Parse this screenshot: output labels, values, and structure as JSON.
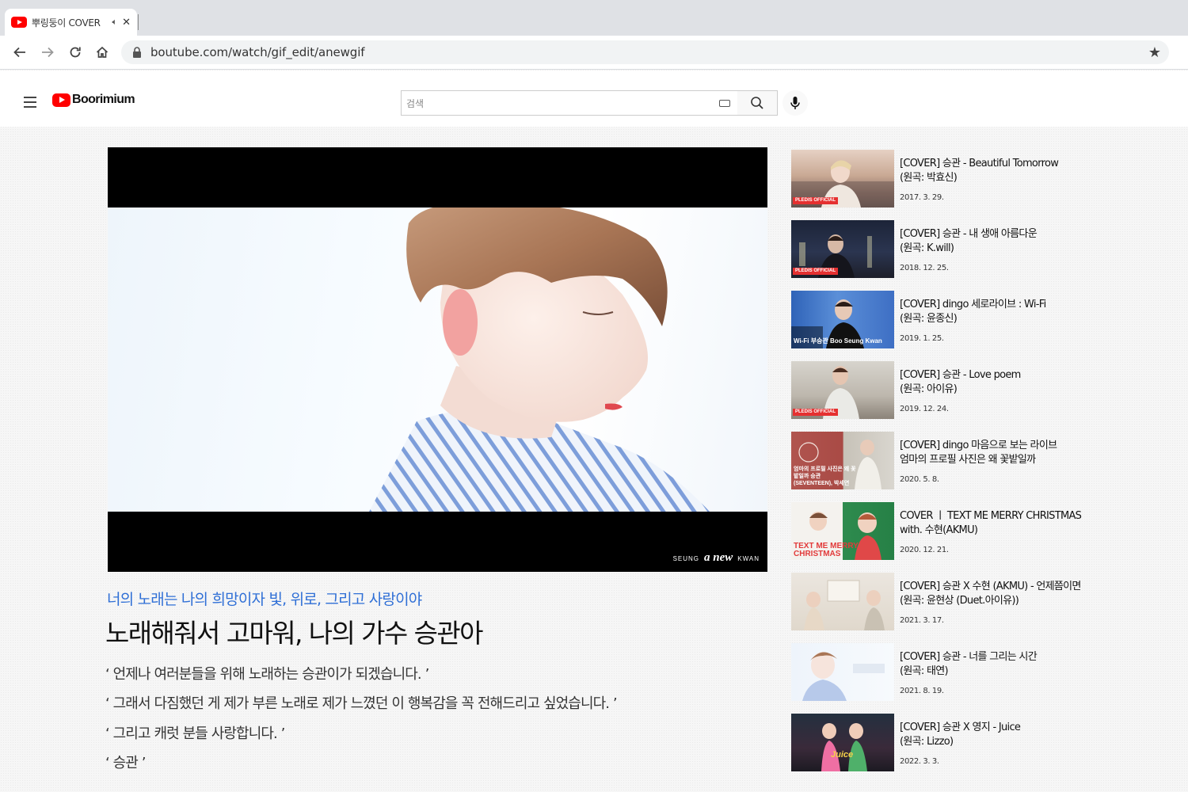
{
  "browser": {
    "tab_title": "뿌링둥이 COVER",
    "url": "boutube.com/watch/gif_edit/anewgif"
  },
  "header": {
    "logo_text": "Boorimium",
    "search_placeholder": "검색"
  },
  "video": {
    "watermark_left": "SEUNG",
    "watermark_center": "a new",
    "watermark_right": "KWAN"
  },
  "main": {
    "subtitle": "너의 노래는 나의 희망이자 빛, 위로, 그리고 사랑이야",
    "title": "노래해줘서 고마워, 나의 가수 승관아",
    "quotes": [
      "‘ 언제나 여러분들을 위해 노래하는 승관이가 되겠습니다. ’",
      "‘ 그래서 다짐했던 게 제가 부른 노래로 제가 느꼈던 이 행복감을 꼭 전해드리고 싶었습니다. ’",
      "‘ 그리고 캐럿 분들 사랑합니다. ’",
      "‘ 승관 ’"
    ]
  },
  "related": [
    {
      "line1": "[COVER] 승관 - Beautiful Tomorrow",
      "line2": "(원곡: 박효신)",
      "date": "2017. 3. 29.",
      "badge": "PLEDIS OFFICIAL",
      "overlay": ""
    },
    {
      "line1": "[COVER] 승관 - 내 생애 아름다운",
      "line2": "(원곡: K.will)",
      "date": "2018. 12. 25.",
      "badge": "PLEDIS OFFICIAL",
      "overlay": ""
    },
    {
      "line1": "[COVER] dingo 세로라이브 : Wi-Fi",
      "line2": "(원곡: 윤종신)",
      "date": "2019. 1. 25.",
      "badge": "",
      "overlay": "Wi-Fi 부승관 Boo Seung Kwan"
    },
    {
      "line1": "[COVER] 승관 - Love poem",
      "line2": "(원곡: 아이유)",
      "date": "2019. 12. 24.",
      "badge": "PLEDIS OFFICIAL",
      "overlay": ""
    },
    {
      "line1": "[COVER] dingo 마음으로 보는 라이브",
      "line2": "엄마의 프로필 사진은 왜 꽃밭일까",
      "date": "2020. 5. 8.",
      "badge": "",
      "overlay": "엄마의 프로필 사진은 왜 꽃밭일까 승관 (SEVENTEEN), 박세연"
    },
    {
      "line1": "COVER ㅣ TEXT ME MERRY CHRISTMAS",
      "line2": "with. 수현(AKMU)",
      "date": "2020. 12. 21.",
      "badge": "",
      "overlay": "TEXT ME MERRY CHRISTMAS"
    },
    {
      "line1": "[COVER] 승관 X 수현 (AKMU) - 언제쯤이면",
      "line2": "(원곡: 윤현상 (Duet.아이유))",
      "date": "2021. 3. 17.",
      "badge": "",
      "overlay": ""
    },
    {
      "line1": "[COVER] 승관 - 너를 그리는 시간",
      "line2": "(원곡: 태연)",
      "date": "2021. 8. 19.",
      "badge": "",
      "overlay": ""
    },
    {
      "line1": "[COVER] 승관 X 영지 - Juice",
      "line2": "(원곡: Lizzo)",
      "date": "2022. 3. 3.",
      "badge": "",
      "overlay": "Juice"
    }
  ],
  "colors": {
    "accent_blue": "#2f6fd6",
    "youtube_red": "#ff0000",
    "badge_red": "#e53030"
  },
  "icons": [
    "youtube-icon",
    "speaker-icon",
    "close-icon",
    "back-icon",
    "forward-icon",
    "reload-icon",
    "home-icon",
    "lock-icon",
    "star-icon",
    "menu-icon",
    "keyboard-icon",
    "search-icon",
    "mic-icon"
  ]
}
